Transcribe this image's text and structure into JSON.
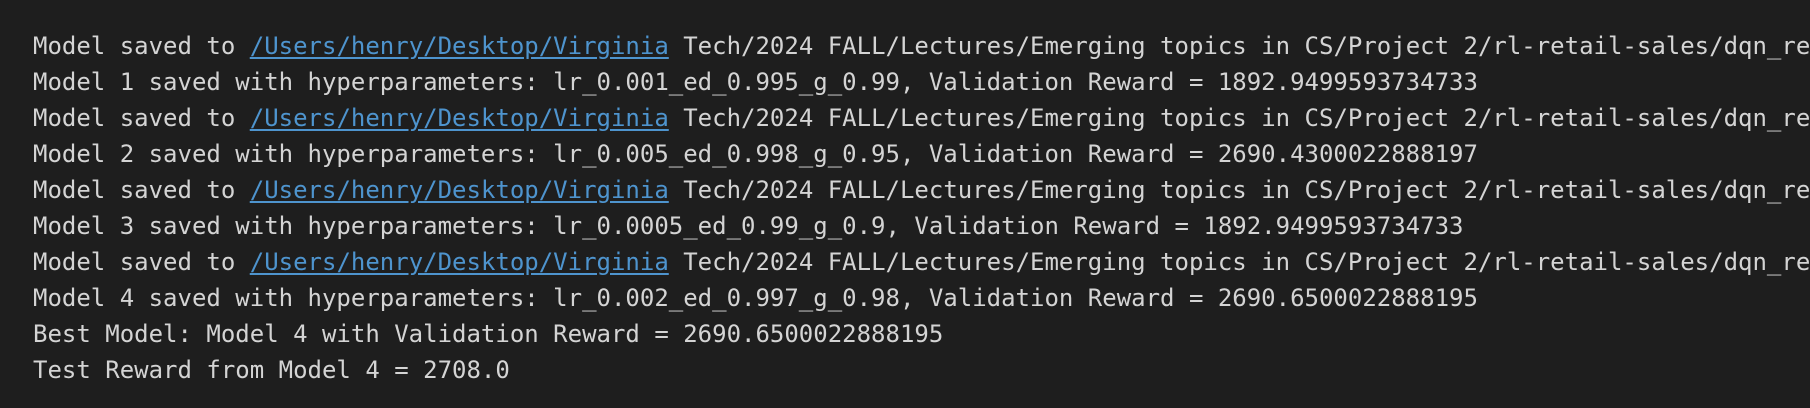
{
  "terminal": {
    "lines": [
      {
        "prefix": "Model saved to ",
        "link": "/Users/henry/Desktop/Virginia",
        "text": " Tech/2024 FALL/Lectures/Emerging topics in CS/Project 2/rl-retail-sales/dqn_re"
      },
      {
        "text": "Model 1 saved with hyperparameters: lr_0.001_ed_0.995_g_0.99, Validation Reward = 1892.9499593734733"
      },
      {
        "prefix": "Model saved to ",
        "link": "/Users/henry/Desktop/Virginia",
        "text": " Tech/2024 FALL/Lectures/Emerging topics in CS/Project 2/rl-retail-sales/dqn_re"
      },
      {
        "text": "Model 2 saved with hyperparameters: lr_0.005_ed_0.998_g_0.95, Validation Reward = 2690.4300022888197"
      },
      {
        "prefix": "Model saved to ",
        "link": "/Users/henry/Desktop/Virginia",
        "text": " Tech/2024 FALL/Lectures/Emerging topics in CS/Project 2/rl-retail-sales/dqn_re"
      },
      {
        "text": "Model 3 saved with hyperparameters: lr_0.0005_ed_0.99_g_0.9, Validation Reward = 1892.9499593734733"
      },
      {
        "prefix": "Model saved to ",
        "link": "/Users/henry/Desktop/Virginia",
        "text": " Tech/2024 FALL/Lectures/Emerging topics in CS/Project 2/rl-retail-sales/dqn_re"
      },
      {
        "text": "Model 4 saved with hyperparameters: lr_0.002_ed_0.997_g_0.98, Validation Reward = 2690.6500022888195"
      },
      {
        "text": "Best Model: Model 4 with Validation Reward = 2690.6500022888195"
      },
      {
        "text": "Test Reward from Model 4 = 2708.0"
      }
    ]
  },
  "colors": {
    "background": "#1e1e1e",
    "text": "#d4d4d4",
    "link": "#4e94ce"
  }
}
